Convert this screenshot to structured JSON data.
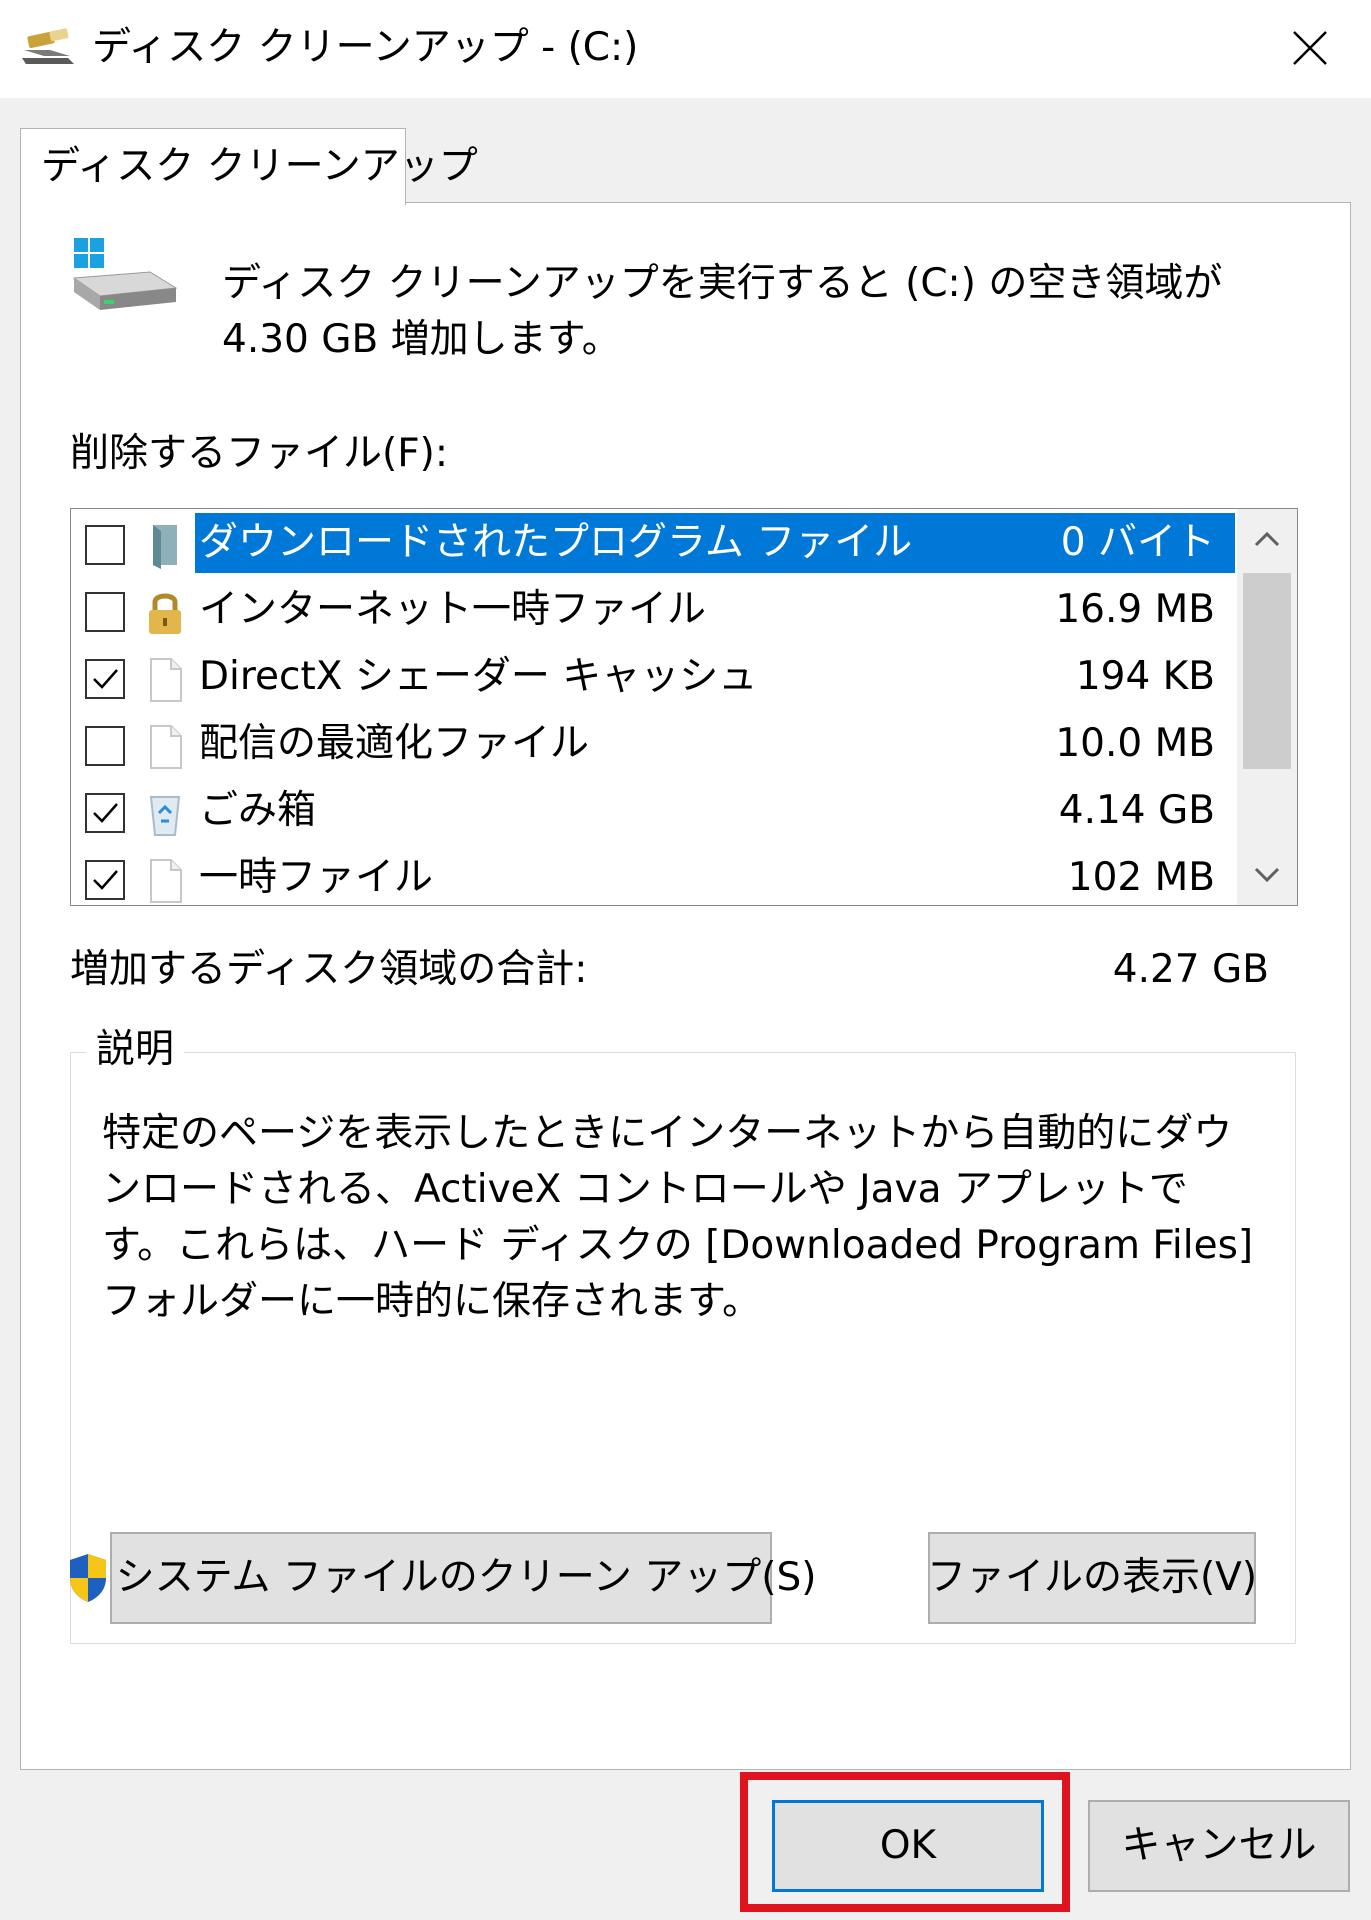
{
  "window": {
    "title": "ディスク クリーンアップ - (C:)"
  },
  "tab": {
    "label": "ディスク クリーンアップ"
  },
  "header": {
    "info": "ディスク クリーンアップを実行すると (C:) の空き領域が 4.30 GB 増加します。"
  },
  "files_label": "削除するファイル(F):",
  "files": [
    {
      "name": "ダウンロードされたプログラム ファイル",
      "size": "0 バイト",
      "checked": false,
      "selected": true,
      "icon": "folder-icon"
    },
    {
      "name": "インターネット一時ファイル",
      "size": "16.9 MB",
      "checked": false,
      "selected": false,
      "icon": "lock-icon"
    },
    {
      "name": "DirectX シェーダー キャッシュ",
      "size": "194 KB",
      "checked": true,
      "selected": false,
      "icon": "file-icon"
    },
    {
      "name": "配信の最適化ファイル",
      "size": "10.0 MB",
      "checked": false,
      "selected": false,
      "icon": "file-icon"
    },
    {
      "name": "ごみ箱",
      "size": "4.14 GB",
      "checked": true,
      "selected": false,
      "icon": "recycle-bin-icon"
    },
    {
      "name": "一時ファイル",
      "size": "102 MB",
      "checked": true,
      "selected": false,
      "icon": "file-icon"
    }
  ],
  "total": {
    "label": "増加するディスク領域の合計:",
    "value": "4.27 GB"
  },
  "description": {
    "title": "説明",
    "text": "特定のページを表示したときにインターネットから自動的にダウンロードされる、ActiveX コントロールや Java アプレットです。これらは、ハード ディスクの [Downloaded Program Files] フォルダーに一時的に保存されます。"
  },
  "buttons": {
    "system_cleanup": "システム ファイルのクリーン アップ(S)",
    "view_files": "ファイルの表示(V)",
    "ok": "OK",
    "cancel": "キャンセル"
  },
  "colors": {
    "selection": "#0078d7",
    "highlight_frame": "#e0141e"
  }
}
